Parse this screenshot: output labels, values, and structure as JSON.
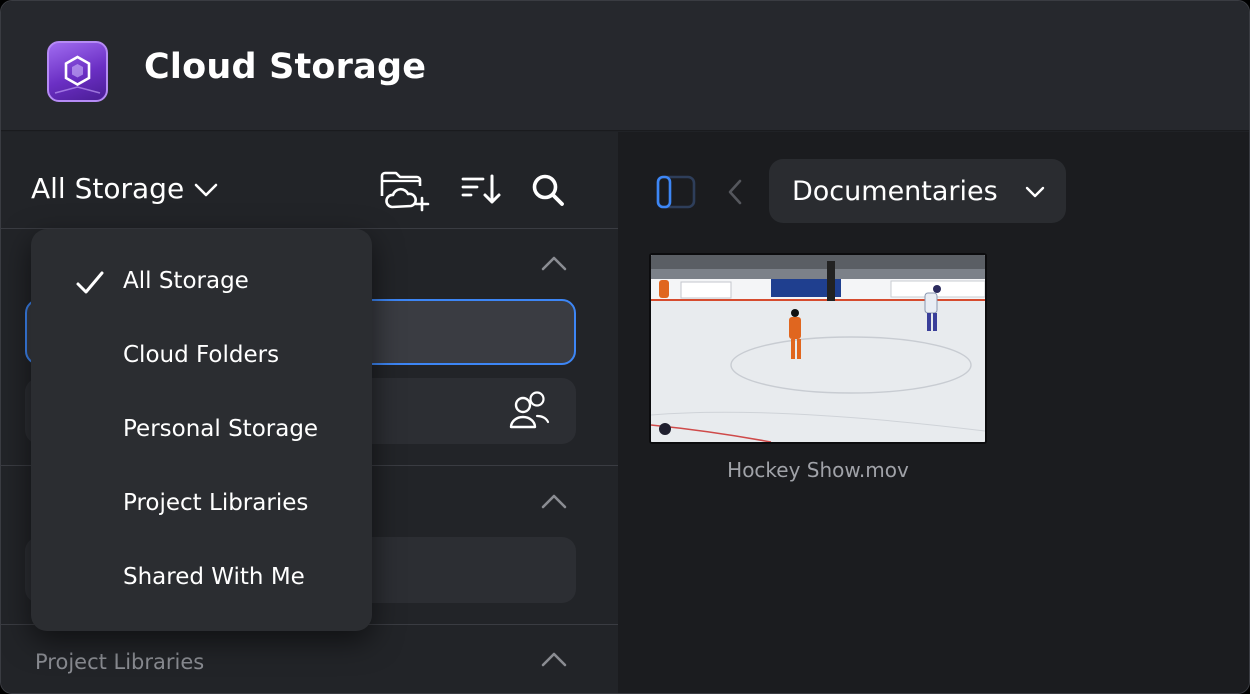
{
  "app": {
    "title": "Cloud Storage",
    "icon": "app-cube-icon",
    "accent": "#3d86f5",
    "icon_color": "#7b3fd6"
  },
  "left_panel": {
    "storage_filter": {
      "selected": "All Storage",
      "icon": "chevron-down-icon"
    },
    "toolbar": [
      {
        "name": "new-cloud-folder",
        "icon": "folder-cloud-plus-icon"
      },
      {
        "name": "sort",
        "icon": "sort-icon"
      },
      {
        "name": "search",
        "icon": "search-icon"
      }
    ],
    "sections": [
      {
        "label": "",
        "collapsed": false
      },
      {
        "label": "",
        "collapsed": false
      },
      {
        "label": "Project Libraries",
        "collapsed": false
      }
    ]
  },
  "dropdown": {
    "open": true,
    "items": [
      {
        "label": "All Storage",
        "checked": true
      },
      {
        "label": "Cloud Folders",
        "checked": false
      },
      {
        "label": "Personal Storage",
        "checked": false
      },
      {
        "label": "Project Libraries",
        "checked": false
      },
      {
        "label": "Shared With Me",
        "checked": false
      }
    ]
  },
  "right_panel": {
    "breadcrumb": {
      "current": "Documentaries",
      "icon": "chevron-down-icon"
    },
    "files": [
      {
        "name": "Hockey Show.mov",
        "thumbnail": "hockey-rink-thumbnail"
      }
    ]
  }
}
